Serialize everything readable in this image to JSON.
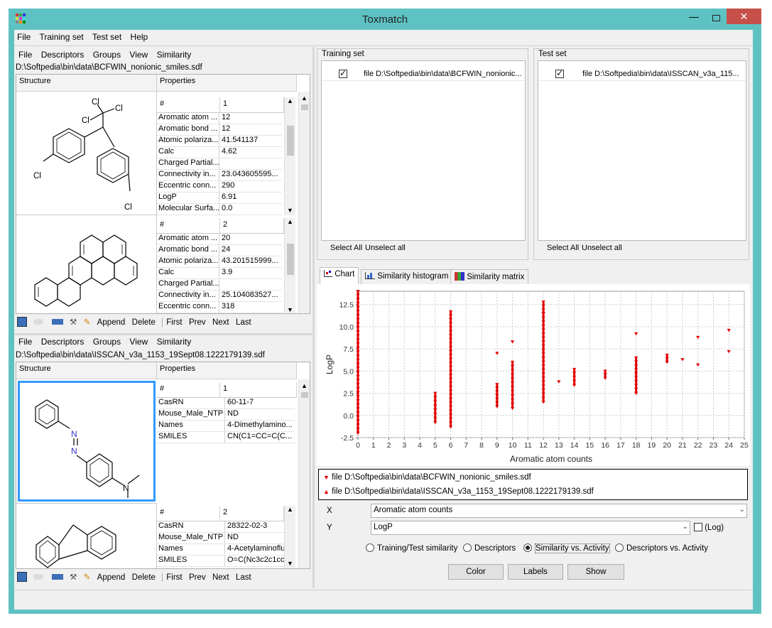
{
  "window": {
    "title": "Toxmatch"
  },
  "menubar": [
    "File",
    "Training set",
    "Test set",
    "Help"
  ],
  "top_dataset": {
    "menu": [
      "File",
      "Descriptors",
      "Groups",
      "View",
      "Similarity"
    ],
    "path": "D:\\Softpedia\\bin\\data\\BCFWIN_nonionic_smiles.sdf",
    "col_structure": "Structure",
    "col_properties": "Properties",
    "records": [
      {
        "num_header": "#",
        "num": "1",
        "props": [
          [
            "Aromatic atom ...",
            "12"
          ],
          [
            "Aromatic bond ...",
            "12"
          ],
          [
            "Atomic polariza...",
            "41.541137"
          ],
          [
            "Calc",
            "4.62"
          ],
          [
            "Charged Partial...",
            ""
          ],
          [
            "Connectivity in...",
            "23.043605595..."
          ],
          [
            "Eccentric conn...",
            "290"
          ],
          [
            "LogP",
            "6.91"
          ],
          [
            "Molecular Surfa...",
            "0.0"
          ]
        ]
      },
      {
        "num_header": "#",
        "num": "2",
        "props": [
          [
            "Aromatic atom ...",
            "20"
          ],
          [
            "Aromatic bond ...",
            "24"
          ],
          [
            "Atomic polariza...",
            "43.201515999..."
          ],
          [
            "Calc",
            "3.9"
          ],
          [
            "Charged Partial...",
            ""
          ],
          [
            "Connectivity in...",
            "25.104083527..."
          ],
          [
            "Eccentric conn...",
            "318"
          ]
        ]
      }
    ],
    "toolbar": [
      "Append",
      "Delete",
      "First",
      "Prev",
      "Next",
      "Last"
    ]
  },
  "bottom_dataset": {
    "menu": [
      "File",
      "Descriptors",
      "Groups",
      "View",
      "Similarity"
    ],
    "path": "D:\\Softpedia\\bin\\data\\ISSCAN_v3a_1153_19Sept08.1222179139.sdf",
    "col_structure": "Structure",
    "col_properties": "Properties",
    "records": [
      {
        "num_header": "#",
        "num": "1",
        "props": [
          [
            "CasRN",
            "60-11-7"
          ],
          [
            "Mouse_Male_NTP",
            "ND"
          ],
          [
            "Names",
            "4-Dimethylamino..."
          ],
          [
            "SMILES",
            "CN(C1=CC=C(C..."
          ]
        ]
      },
      {
        "num_header": "#",
        "num": "2",
        "props": [
          [
            "CasRN",
            "28322-02-3"
          ],
          [
            "Mouse_Male_NTP",
            "ND"
          ],
          [
            "Names",
            "4-Acetylaminoflu..."
          ],
          [
            "SMILES",
            "O=C(Nc3c2c1ccc..."
          ]
        ]
      }
    ],
    "toolbar": [
      "Append",
      "Delete",
      "First",
      "Prev",
      "Next",
      "Last"
    ]
  },
  "training_set": {
    "label": "Training set",
    "file": "file D:\\Softpedia\\bin\\data\\BCFWIN_nonionic...",
    "select_all": "Select All",
    "unselect_all": "Unselect all"
  },
  "test_set": {
    "label": "Test set",
    "file": "file D:\\Softpedia\\bin\\data\\ISSCAN_v3a_115...",
    "select_all": "Select All",
    "unselect_all": "Unselect all"
  },
  "tabs": [
    "Chart",
    "Similarity histogram",
    "Similarity matrix"
  ],
  "legend": [
    "file D:\\Softpedia\\bin\\data\\BCFWIN_nonionic_smiles.sdf",
    "file D:\\Softpedia\\bin\\data\\ISSCAN_v3a_1153_19Sept08.1222179139.sdf"
  ],
  "controls": {
    "x_label": "X",
    "x_value": "Aromatic atom counts",
    "y_label": "Y",
    "y_value": "LogP",
    "log_label": "(Log)",
    "radios": [
      "Training/Test similarity",
      "Descriptors",
      "Similarity vs. Activity",
      "Descriptors vs. Activity"
    ],
    "radio_selected": 2,
    "buttons": [
      "Color",
      "Labels",
      "Show"
    ]
  },
  "colors": {
    "accent": "#5ec2c2",
    "points": "#e00000",
    "selection": "#3399ff"
  },
  "chart_data": {
    "type": "scatter",
    "xlabel": "Aromatic atom counts",
    "ylabel": "LogP",
    "xlim": [
      0,
      25
    ],
    "ylim": [
      -2.5,
      14
    ],
    "xticks": [
      "0",
      "1",
      "2",
      "3",
      "4",
      "5",
      "6",
      "7",
      "8",
      "9",
      "10",
      "11",
      "12",
      "13",
      "14",
      "15",
      "16",
      "17",
      "18",
      "19",
      "20",
      "21",
      "22",
      "23",
      "24",
      "25"
    ],
    "yticks": [
      "-2.5",
      "0.0",
      "2.5",
      "5.0",
      "7.5",
      "10.0",
      "12.5"
    ],
    "grid": true,
    "series": [
      {
        "columns": [
          {
            "x": 0,
            "ymin": -2.0,
            "ymax": 14.0
          },
          {
            "x": 5,
            "ymin": -0.8,
            "ymax": 2.5
          },
          {
            "x": 6,
            "ymin": -1.3,
            "ymax": 11.7
          },
          {
            "x": 9,
            "ymin": 1.0,
            "ymax": 3.5
          },
          {
            "x": 10,
            "ymin": 0.8,
            "ymax": 6.0
          },
          {
            "x": 12,
            "ymin": 1.5,
            "ymax": 12.8
          },
          {
            "x": 13,
            "ymin": 3.8,
            "ymax": 3.8
          },
          {
            "x": 14,
            "ymin": 3.4,
            "ymax": 5.2
          },
          {
            "x": 16,
            "ymin": 4.2,
            "ymax": 5.0
          },
          {
            "x": 18,
            "ymin": 2.5,
            "ymax": 6.5
          },
          {
            "x": 20,
            "ymin": 6.0,
            "ymax": 6.8
          },
          {
            "x": 21,
            "ymin": 6.3,
            "ymax": 6.3
          },
          {
            "x": 22,
            "ymin": 5.7,
            "ymax": 5.7
          },
          {
            "x": 24,
            "ymin": 7.2,
            "ymax": 7.2
          }
        ],
        "extra": [
          {
            "x": 9,
            "y": 7.0
          },
          {
            "x": 10,
            "y": 8.3
          },
          {
            "x": 18,
            "y": 9.2
          },
          {
            "x": 22,
            "y": 8.8
          },
          {
            "x": 24,
            "y": 9.6
          },
          {
            "x": 12,
            "y": 11.5
          }
        ]
      }
    ]
  }
}
